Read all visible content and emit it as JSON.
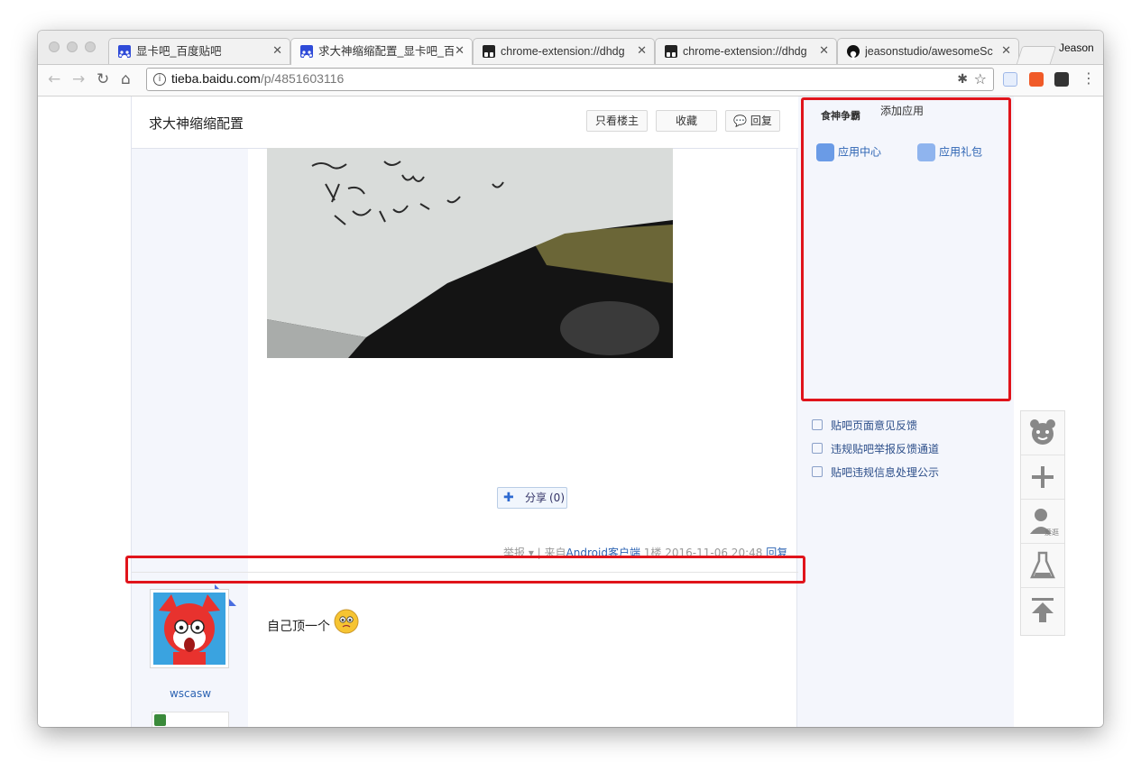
{
  "browser": {
    "tabs": [
      {
        "title": "显卡吧_百度贴吧",
        "icon": "baidu-paw-icon",
        "active": false
      },
      {
        "title": "求大神缩缩配置_显卡吧_百",
        "icon": "baidu-paw-icon",
        "active": true
      },
      {
        "title": "chrome-extension://dhdg",
        "icon": "extension-icon",
        "active": false
      },
      {
        "title": "chrome-extension://dhdg",
        "icon": "extension-icon",
        "active": false
      },
      {
        "title": "jeasonstudio/awesomeSc",
        "icon": "github-icon",
        "active": false
      }
    ],
    "profile_name": "Jeason",
    "url_host": "tieba.baidu.com",
    "url_path": "/p/4851603116"
  },
  "thread": {
    "title": "求大神缩缩配置",
    "buttons": {
      "only_op": "只看楼主",
      "favorite": "收藏",
      "reply": "回复"
    }
  },
  "post1": {
    "share_label": "分享",
    "share_count": "(0)",
    "meta": {
      "report": "举报",
      "source_prefix": "来自",
      "source_link": "Android客户端",
      "floor": "1楼",
      "time": "2016-11-06 20:48",
      "reply": "回复"
    }
  },
  "post2": {
    "username": "wscasw",
    "content": "自己顶一个"
  },
  "sidebar": {
    "app_tabs": [
      "食神争霸",
      "添加应用"
    ],
    "apps": [
      {
        "label": "应用中心",
        "icon": "app-center-icon"
      },
      {
        "label": "应用礼包",
        "icon": "gift-icon"
      }
    ],
    "links": [
      {
        "label": "贴吧页面意见反馈",
        "icon": "edit-icon"
      },
      {
        "label": "违规贴吧举报反馈通道",
        "icon": "report-icon"
      },
      {
        "label": "贴吧违规信息处理公示",
        "icon": "trash-icon"
      }
    ]
  },
  "floatbar": {
    "items": [
      "bear-icon",
      "plus-icon",
      "user-icon",
      "flask-icon",
      "back-to-top-icon"
    ],
    "user_badge": "爱逛"
  },
  "colors": {
    "highlight_red": "#e0141b",
    "link_blue": "#2d64b3",
    "sidebar_bg": "#f4f6fc"
  }
}
